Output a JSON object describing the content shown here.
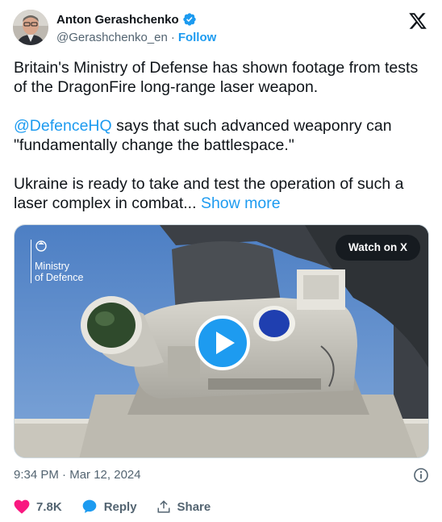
{
  "author": {
    "name": "Anton Gerashchenko",
    "handle": "@Gerashchenko_en",
    "separator": "·",
    "follow_label": "Follow"
  },
  "tweet": {
    "para1": "Britain's Ministry of Defense has shown footage from tests of the DragonFire long-range laser weapon.",
    "mention": "@DefenceHQ",
    "para2_rest": " says that such advanced weaponry can \"fundamentally change the battlespace.\"",
    "para3": "Ukraine is ready to take and test the operation of such a laser complex in combat...",
    "show_more": "Show more"
  },
  "media": {
    "watermark_line1": "Ministry",
    "watermark_line2": "of Defence",
    "watch_label": "Watch on X"
  },
  "meta": {
    "time": "9:34 PM",
    "separator": "·",
    "date": "Mar 12, 2024"
  },
  "actions": {
    "likes": "7.8K",
    "reply_label": "Reply",
    "share_label": "Share"
  },
  "colors": {
    "accent": "#1d9bf0",
    "like": "#f91880",
    "secondary_text": "#536471"
  },
  "icons": [
    "verified-badge-icon",
    "x-logo-icon",
    "play-icon",
    "info-icon",
    "heart-icon",
    "reply-icon",
    "share-icon",
    "crest-icon"
  ]
}
